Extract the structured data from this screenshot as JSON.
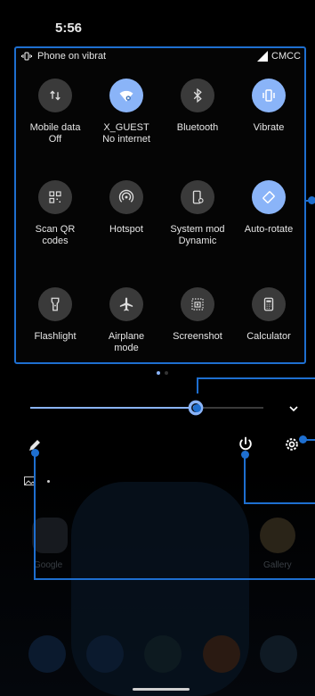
{
  "status_bar": {
    "time": "5:56"
  },
  "qs_header": {
    "mode": "Phone on vibrat",
    "carrier": "CMCC"
  },
  "tiles": [
    {
      "label": "Mobile data",
      "sub": "Off",
      "icon": "mobile-data-icon",
      "on": false
    },
    {
      "label": "X_GUEST",
      "sub": "No internet",
      "icon": "wifi-icon",
      "on": true
    },
    {
      "label": "Bluetooth",
      "sub": "",
      "icon": "bluetooth-icon",
      "on": false
    },
    {
      "label": "Vibrate",
      "sub": "",
      "icon": "vibrate-icon",
      "on": true
    },
    {
      "label": "Scan QR",
      "sub": "codes",
      "icon": "qr-icon",
      "on": false
    },
    {
      "label": "Hotspot",
      "sub": "",
      "icon": "hotspot-icon",
      "on": false
    },
    {
      "label": "System mod",
      "sub": "Dynamic",
      "icon": "system-mode-icon",
      "on": false
    },
    {
      "label": "Auto-rotate",
      "sub": "",
      "icon": "auto-rotate-icon",
      "on": true
    },
    {
      "label": "Flashlight",
      "sub": "",
      "icon": "flashlight-icon",
      "on": false
    },
    {
      "label": "Airplane",
      "sub": "mode",
      "icon": "airplane-icon",
      "on": false
    },
    {
      "label": "Screenshot",
      "sub": "",
      "icon": "screenshot-icon",
      "on": false
    },
    {
      "label": "Calculator",
      "sub": "",
      "icon": "calculator-icon",
      "on": false
    }
  ],
  "brightness": {
    "level": 0.71
  },
  "home": {
    "folder_label": "Google",
    "gallery_label": "Gallery"
  },
  "colors": {
    "accent": "#8ab4f8",
    "annotation": "#1e6fd0",
    "tile_off": "#3a3a3a"
  }
}
